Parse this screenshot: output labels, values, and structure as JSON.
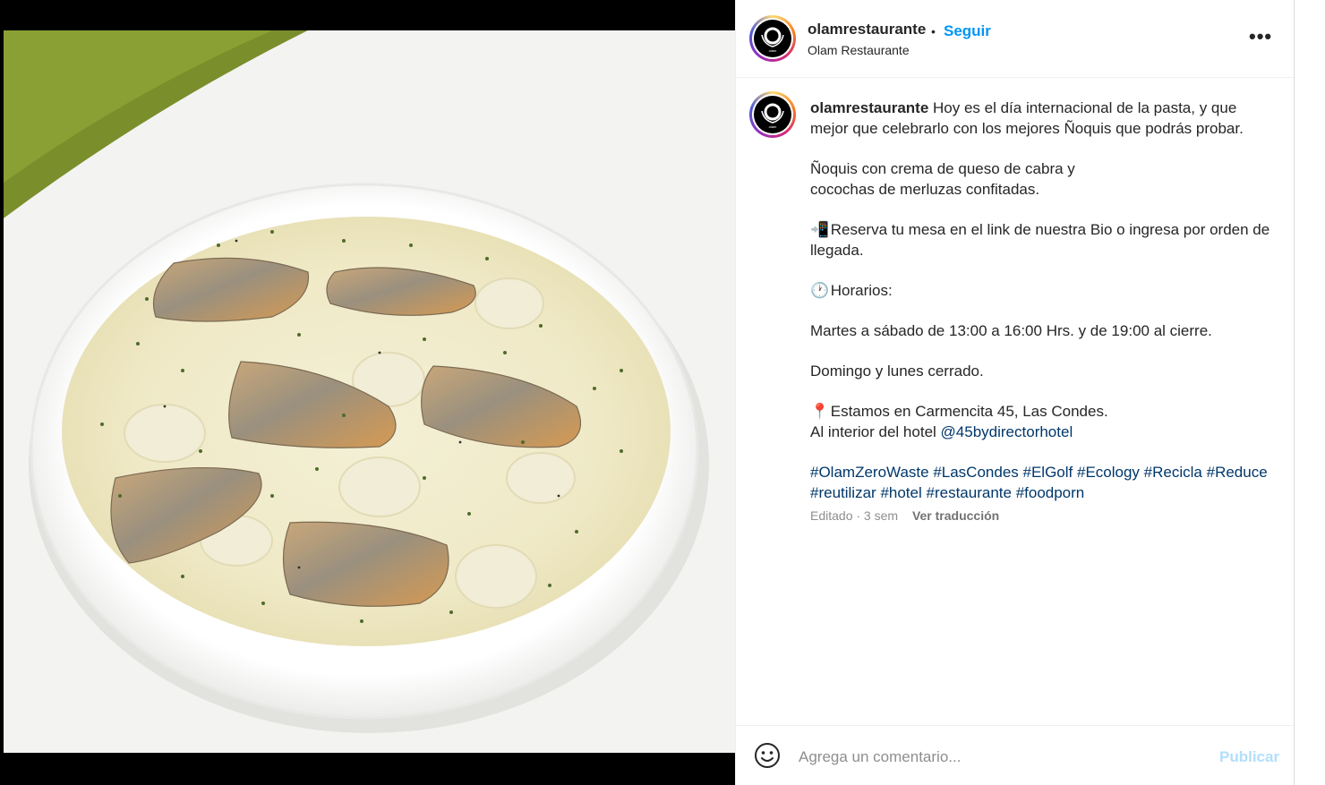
{
  "post": {
    "username": "olamrestaurante",
    "follow_label": "Seguir",
    "location": "Olam Restaurante",
    "avatar_text": "olam",
    "more_label": "•••"
  },
  "caption": {
    "username": "olamrestaurante",
    "line1": "Hoy es el día internacional de la pasta, y que mejor que celebrarlo con los mejores Ñoquis que podrás probar.",
    "dish_line1": "Ñoquis con crema de queso de cabra y",
    "dish_line2": "cocochas de merluzas confitadas.",
    "reserve": "Reserva tu mesa en el link de nuestra Bio o ingresa por orden de llegada.",
    "reserve_emoji": "📲",
    "hours_emoji": "🕐",
    "hours_title": "Horarios:",
    "hours_weekdays": "Martes a sábado de 13:00 a 16:00 Hrs. y de 19:00 al cierre.",
    "hours_closed": "Domingo y lunes cerrado.",
    "pin_emoji": "📍",
    "address": "Estamos en Carmencita 45, Las Condes.",
    "hotel_prefix": "Al interior del hotel",
    "hotel_link": "@45bydirectorhotel",
    "hashtags": [
      "#OlamZeroWaste",
      "#LasCondes",
      "#ElGolf",
      "#Ecology",
      "#Recicla",
      "#Reduce",
      "#reutilizar",
      "#hotel",
      "#restaurante",
      "#foodporn"
    ]
  },
  "meta": {
    "edited": "Editado · 3 sem",
    "translate": "Ver traducción"
  },
  "comment": {
    "placeholder": "Agrega un comentario...",
    "publish": "Publicar"
  },
  "colors": {
    "accent": "#0095f6",
    "link": "#00376b",
    "publish_disabled": "#b2dffc",
    "muted": "#8e8e8e"
  }
}
